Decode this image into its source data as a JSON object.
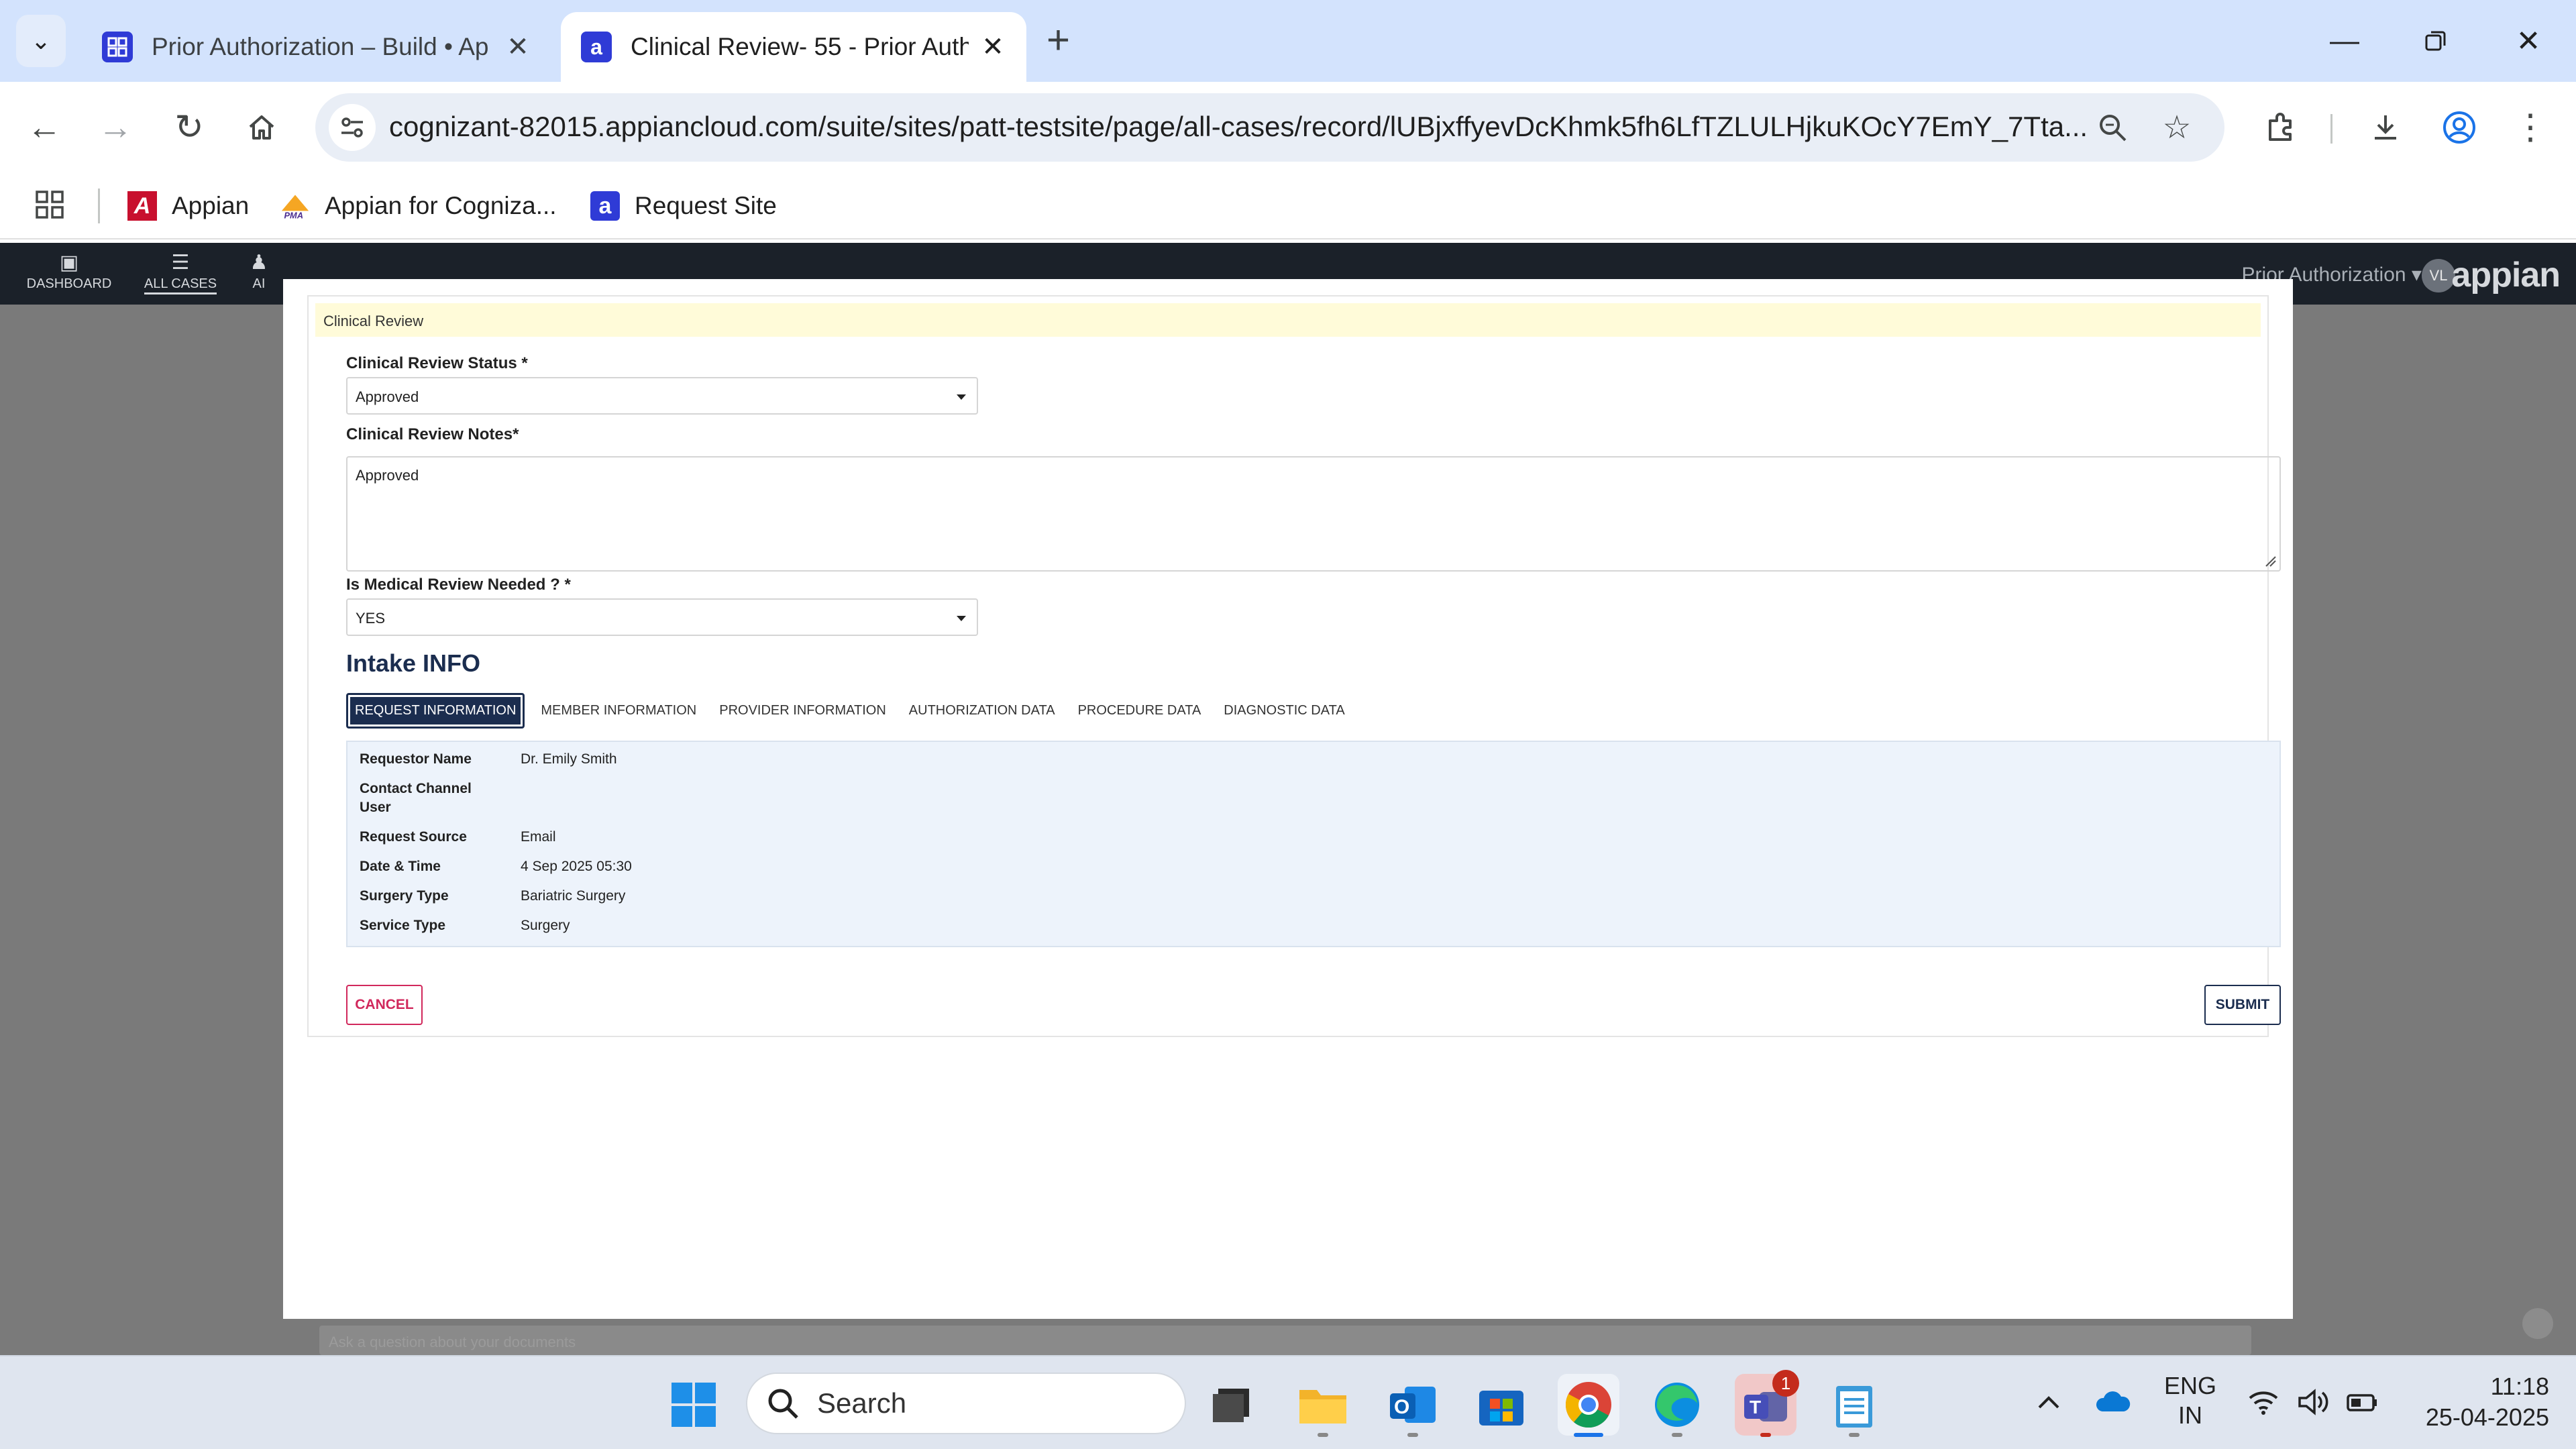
{
  "browser": {
    "tabs": [
      {
        "title": "Prior Authorization – Build • Ap",
        "active": false
      },
      {
        "title": "Clinical Review- 55 - Prior Autho",
        "active": true
      }
    ],
    "new_tab": "+",
    "url": "cognizant-82015.appiancloud.com/suite/sites/patt-testsite/page/all-cases/record/lUBjxffyevDcKhmk5fh6LfTZLULHjkuKOcY7EmY_7Tta...",
    "bookmarks": [
      {
        "label": "Appian"
      },
      {
        "label": "Appian for Cogniza..."
      },
      {
        "label": "Request Site"
      }
    ]
  },
  "appian": {
    "nav": [
      {
        "label": "DASHBOARD",
        "icon": "dashboard-icon"
      },
      {
        "label": "ALL CASES",
        "icon": "list-icon"
      },
      {
        "label": "AI",
        "icon": "person-icon"
      }
    ],
    "app_name": "Prior Authorization",
    "avatar_initials": "VL",
    "logo": "appian"
  },
  "form": {
    "section_header": "Clinical Review",
    "status_label": "Clinical Review Status *",
    "status_value": "Approved",
    "notes_label": "Clinical Review Notes*",
    "notes_value": "Approved",
    "medical_label": "Is Medical Review Needed ? *",
    "medical_value": "YES",
    "intake_title": "Intake INFO",
    "tabs": [
      {
        "label": "REQUEST INFORMATION",
        "active": true
      },
      {
        "label": "MEMBER INFORMATION",
        "active": false
      },
      {
        "label": "PROVIDER INFORMATION",
        "active": false
      },
      {
        "label": "AUTHORIZATION DATA",
        "active": false
      },
      {
        "label": "PROCEDURE DATA",
        "active": false
      },
      {
        "label": "DIAGNOSTIC DATA",
        "active": false
      }
    ],
    "request_info": [
      {
        "key": "Requestor Name",
        "value": "Dr. Emily Smith"
      },
      {
        "key": "Contact Channel User",
        "value": ""
      },
      {
        "key": "Request Source",
        "value": "Email"
      },
      {
        "key": "Date & Time",
        "value": "4 Sep 2025 05:30"
      },
      {
        "key": "Surgery Type",
        "value": "Bariatric Surgery"
      },
      {
        "key": "Service Type",
        "value": "Surgery"
      }
    ],
    "cancel_label": "CANCEL",
    "submit_label": "SUBMIT",
    "backdrop_input_placeholder": "Ask a question about your documents"
  },
  "taskbar": {
    "search_label": "Search",
    "teams_badge": "1",
    "lang_line1": "ENG",
    "lang_line2": "IN",
    "time": "11:18",
    "date": "25-04-2025"
  }
}
